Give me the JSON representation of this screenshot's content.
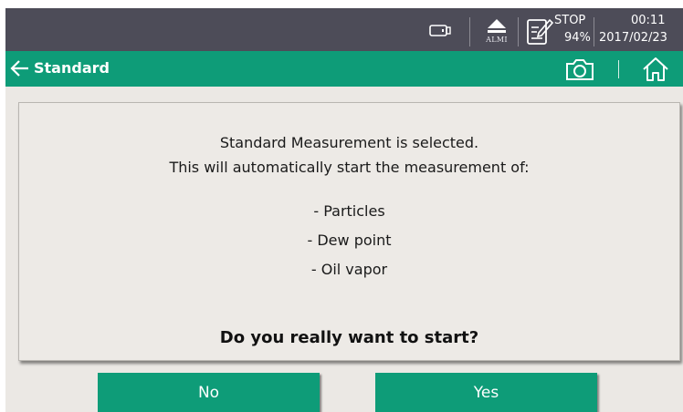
{
  "status_bar": {
    "usb_icon": "usb-stick-icon",
    "alarm_icon": "alarm-triangle-icon",
    "alarm_label": "ALMI",
    "logger_icon": "logger-edit-icon",
    "logger_status": "STOP",
    "logger_percent": "94%",
    "time": "00:11",
    "date": "2017/02/23"
  },
  "title_bar": {
    "back_icon": "back-arrow-icon",
    "title": "Standard",
    "camera_icon": "camera-icon",
    "home_icon": "home-icon"
  },
  "dialog": {
    "line1": "Standard Measurement is selected.",
    "line2": "This will automatically start the measurement of:",
    "items": [
      "- Particles",
      "- Dew point",
      "- Oil vapor"
    ],
    "question": "Do you really want to start?"
  },
  "buttons": {
    "no_label": "No",
    "yes_label": "Yes"
  },
  "colors": {
    "accent_green": "#0e9c78",
    "status_bar": "#4d4c58",
    "background": "#ebe8e4"
  }
}
